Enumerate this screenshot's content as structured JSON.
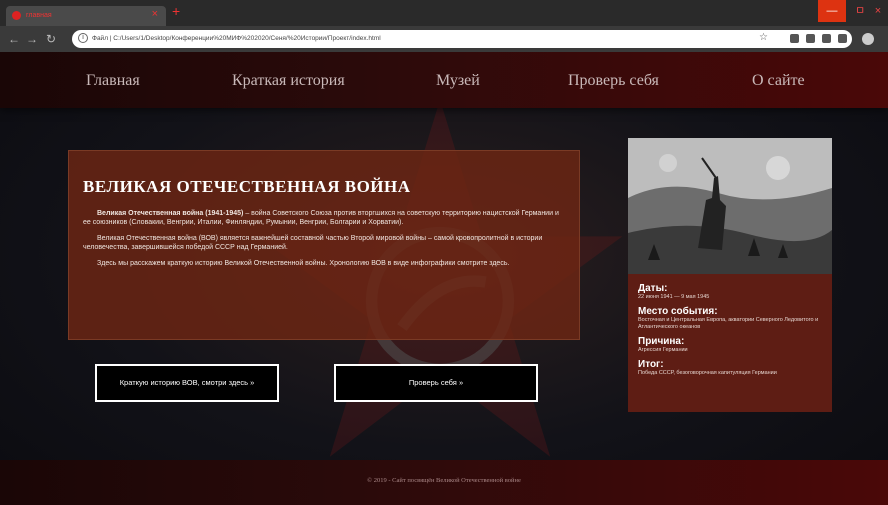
{
  "browser": {
    "tab_title": "главная",
    "tab_close": "×",
    "new_tab": "+",
    "url": "Файл | C:/Users/1/Desktop/Конференции%20МИФ%202020/Сеня/%20Истории/Проект/index.html",
    "window_min": "—",
    "window_max": "ㅁ",
    "window_close": "×"
  },
  "nav": {
    "items": [
      "Главная",
      "Краткая история",
      "Музей",
      "Проверь себя",
      "О сайте"
    ]
  },
  "main": {
    "title": "ВЕЛИКАЯ ОТЕЧЕСТВЕННАЯ ВОЙНА",
    "p1_bold": "Великая Отечественная война (1941-1945)",
    "p1_rest": " – война Советского Союза против вторгшихся на советскую территорию нацистской Германии и ее союзников (Словакии, Венгрии, Италии, Финляндии, Румынии, Венгрии, Болгарии и Хорватии).",
    "p2": "Великая Отечественная война (ВОВ) является важнейшей составной частью Второй мировой войны – самой кровопролитной в истории человечества, завершившейся победой СССР над Германией.",
    "p3": "Здесь мы расскажем краткую историю Великой Отечественной войны. Хронологию ВОВ в виде инфографики смотрите здесь."
  },
  "buttons": {
    "history": "Краткую историю ВОВ, смотри здесь »",
    "quiz": "Проверь себя »"
  },
  "facts": {
    "dates_label": "Даты:",
    "dates_value": "22 июня 1941 — 9 мая 1945",
    "place_label": "Место события:",
    "place_value": "Восточная и Центральная Европа, акватории Северного Ледовитого и Атлантического океанов",
    "cause_label": "Причина:",
    "cause_value": "Агрессия Германии",
    "result_label": "Итог:",
    "result_value": "Победа СССР, безоговорочная капитуляция Германии"
  },
  "footer": {
    "text": "© 2019 - Сайт посвящён Великой Отечественной войне"
  },
  "colors": {
    "accent_red": "#c00000",
    "panel_brown": "#6e2614",
    "card_brown": "#5e1d14"
  }
}
